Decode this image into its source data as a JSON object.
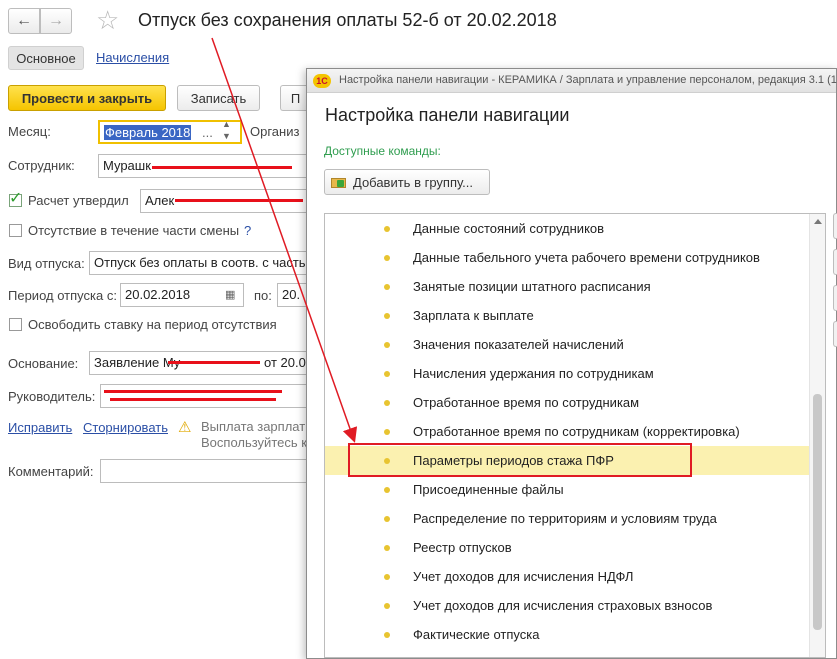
{
  "document": {
    "title": "Отпуск без сохранения оплаты 52-б от 20.02.2018",
    "tabs": [
      "Основное",
      "Начисления"
    ],
    "toolbar": {
      "post_close_label": "Провести и закрыть",
      "save_label": "Записать",
      "cut_label": "П"
    },
    "month": {
      "label": "Месяц:",
      "value": "Февраль 2018",
      "org_label": "Организ"
    },
    "employee": {
      "label": "Сотрудник:",
      "value": "Мурашк"
    },
    "approved": {
      "label": "Расчет утвердил",
      "value": "Алек"
    },
    "partial_shift": {
      "label": "Отсутствие в течение части смены",
      "help": "?"
    },
    "leave_type": {
      "label": "Вид отпуска:",
      "value": "Отпуск без оплаты в соотв. с часть"
    },
    "period": {
      "label": "Период отпуска с:",
      "from": "20.02.2018",
      "to_label": "по:",
      "to": "20."
    },
    "free_rate": {
      "label": "Освободить ставку на период отсутствия"
    },
    "basis": {
      "label": "Основание:",
      "value": "Заявление Му",
      "value_tail": "от 20.0"
    },
    "manager": {
      "label": "Руководитель:"
    },
    "links": {
      "fix": "Исправить",
      "reverse": "Сторнировать"
    },
    "warning": {
      "line1": "Выплата зарплаты",
      "line2": "Воспользуйтесь к"
    },
    "comment": {
      "label": "Комментарий:"
    }
  },
  "dialog": {
    "window_title": "Настройка панели навигации - КЕРАМИКА / Зарплата и управление персоналом, редакция 3.1  (1",
    "logo_text": "1С",
    "heading": "Настройка панели навигации",
    "subheading": "Доступные команды:",
    "add_group_label": "Добавить в группу...",
    "selected_index": 8,
    "items": [
      "Данные состояний сотрудников",
      "Данные табельного учета рабочего времени сотрудников",
      "Занятые позиции штатного расписания",
      "Зарплата к выплате",
      "Значения показателей начислений",
      "Начисления удержания по сотрудникам",
      "Отработанное время по сотрудникам",
      "Отработанное время по сотрудникам (корректировка)",
      "Параметры периодов стажа ПФР",
      "Присоединенные файлы",
      "Распределение по территориям и условиям труда",
      "Реестр отпусков",
      "Учет доходов для исчисления НДФЛ",
      "Учет доходов для исчисления страховых взносов",
      "Фактические отпуска"
    ]
  },
  "colors": {
    "accent_yellow": "#f5c400",
    "selection_blue": "#3a66c4",
    "annotation_red": "#e01b24",
    "link_blue": "#2b4fa6",
    "selected_row": "#fbf1b0"
  }
}
